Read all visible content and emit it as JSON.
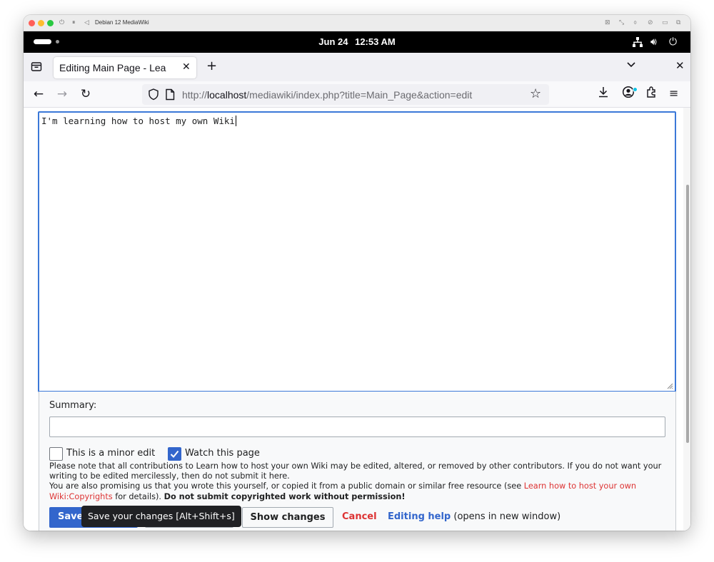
{
  "vm_window": {
    "title": "Debian 12 MediaWiki"
  },
  "gnome_bar": {
    "date": "Jun 24",
    "time": "12:53 AM"
  },
  "browser": {
    "tab_title": "Editing Main Page - Learn how to host your own Wiki",
    "url_prefix": "http://",
    "url_host": "localhost",
    "url_path": "/mediawiki/index.php?title=Main_Page&action=edit"
  },
  "editor": {
    "text": "I'm learning how to host my own Wiki"
  },
  "edit_options": {
    "summary_label": "Summary:",
    "summary_value": "",
    "minor_edit_label": "This is a minor edit",
    "minor_edit_checked": false,
    "watch_label": "Watch this page",
    "watch_checked": true,
    "notice_line1": "Please note that all contributions to Learn how to host your own Wiki may be edited, altered, or removed by other contributors. If you do not want your writing to be edited mercilessly, then do not submit it here.",
    "notice_line2_pre": "You are also promising us that you wrote this yourself, or copied it from a public domain or similar free resource (see ",
    "notice_link": "Learn how to host your own Wiki:Copyrights",
    "notice_line2_post": " for details). ",
    "notice_bold": "Do not submit copyrighted work without permission!"
  },
  "buttons": {
    "save": "Save",
    "show_changes": "Show changes",
    "cancel": "Cancel",
    "editing_help": "Editing help",
    "editing_help_suffix": "(opens in new window)"
  },
  "tooltip": {
    "text": "Save your changes [Alt+Shift+s]"
  }
}
